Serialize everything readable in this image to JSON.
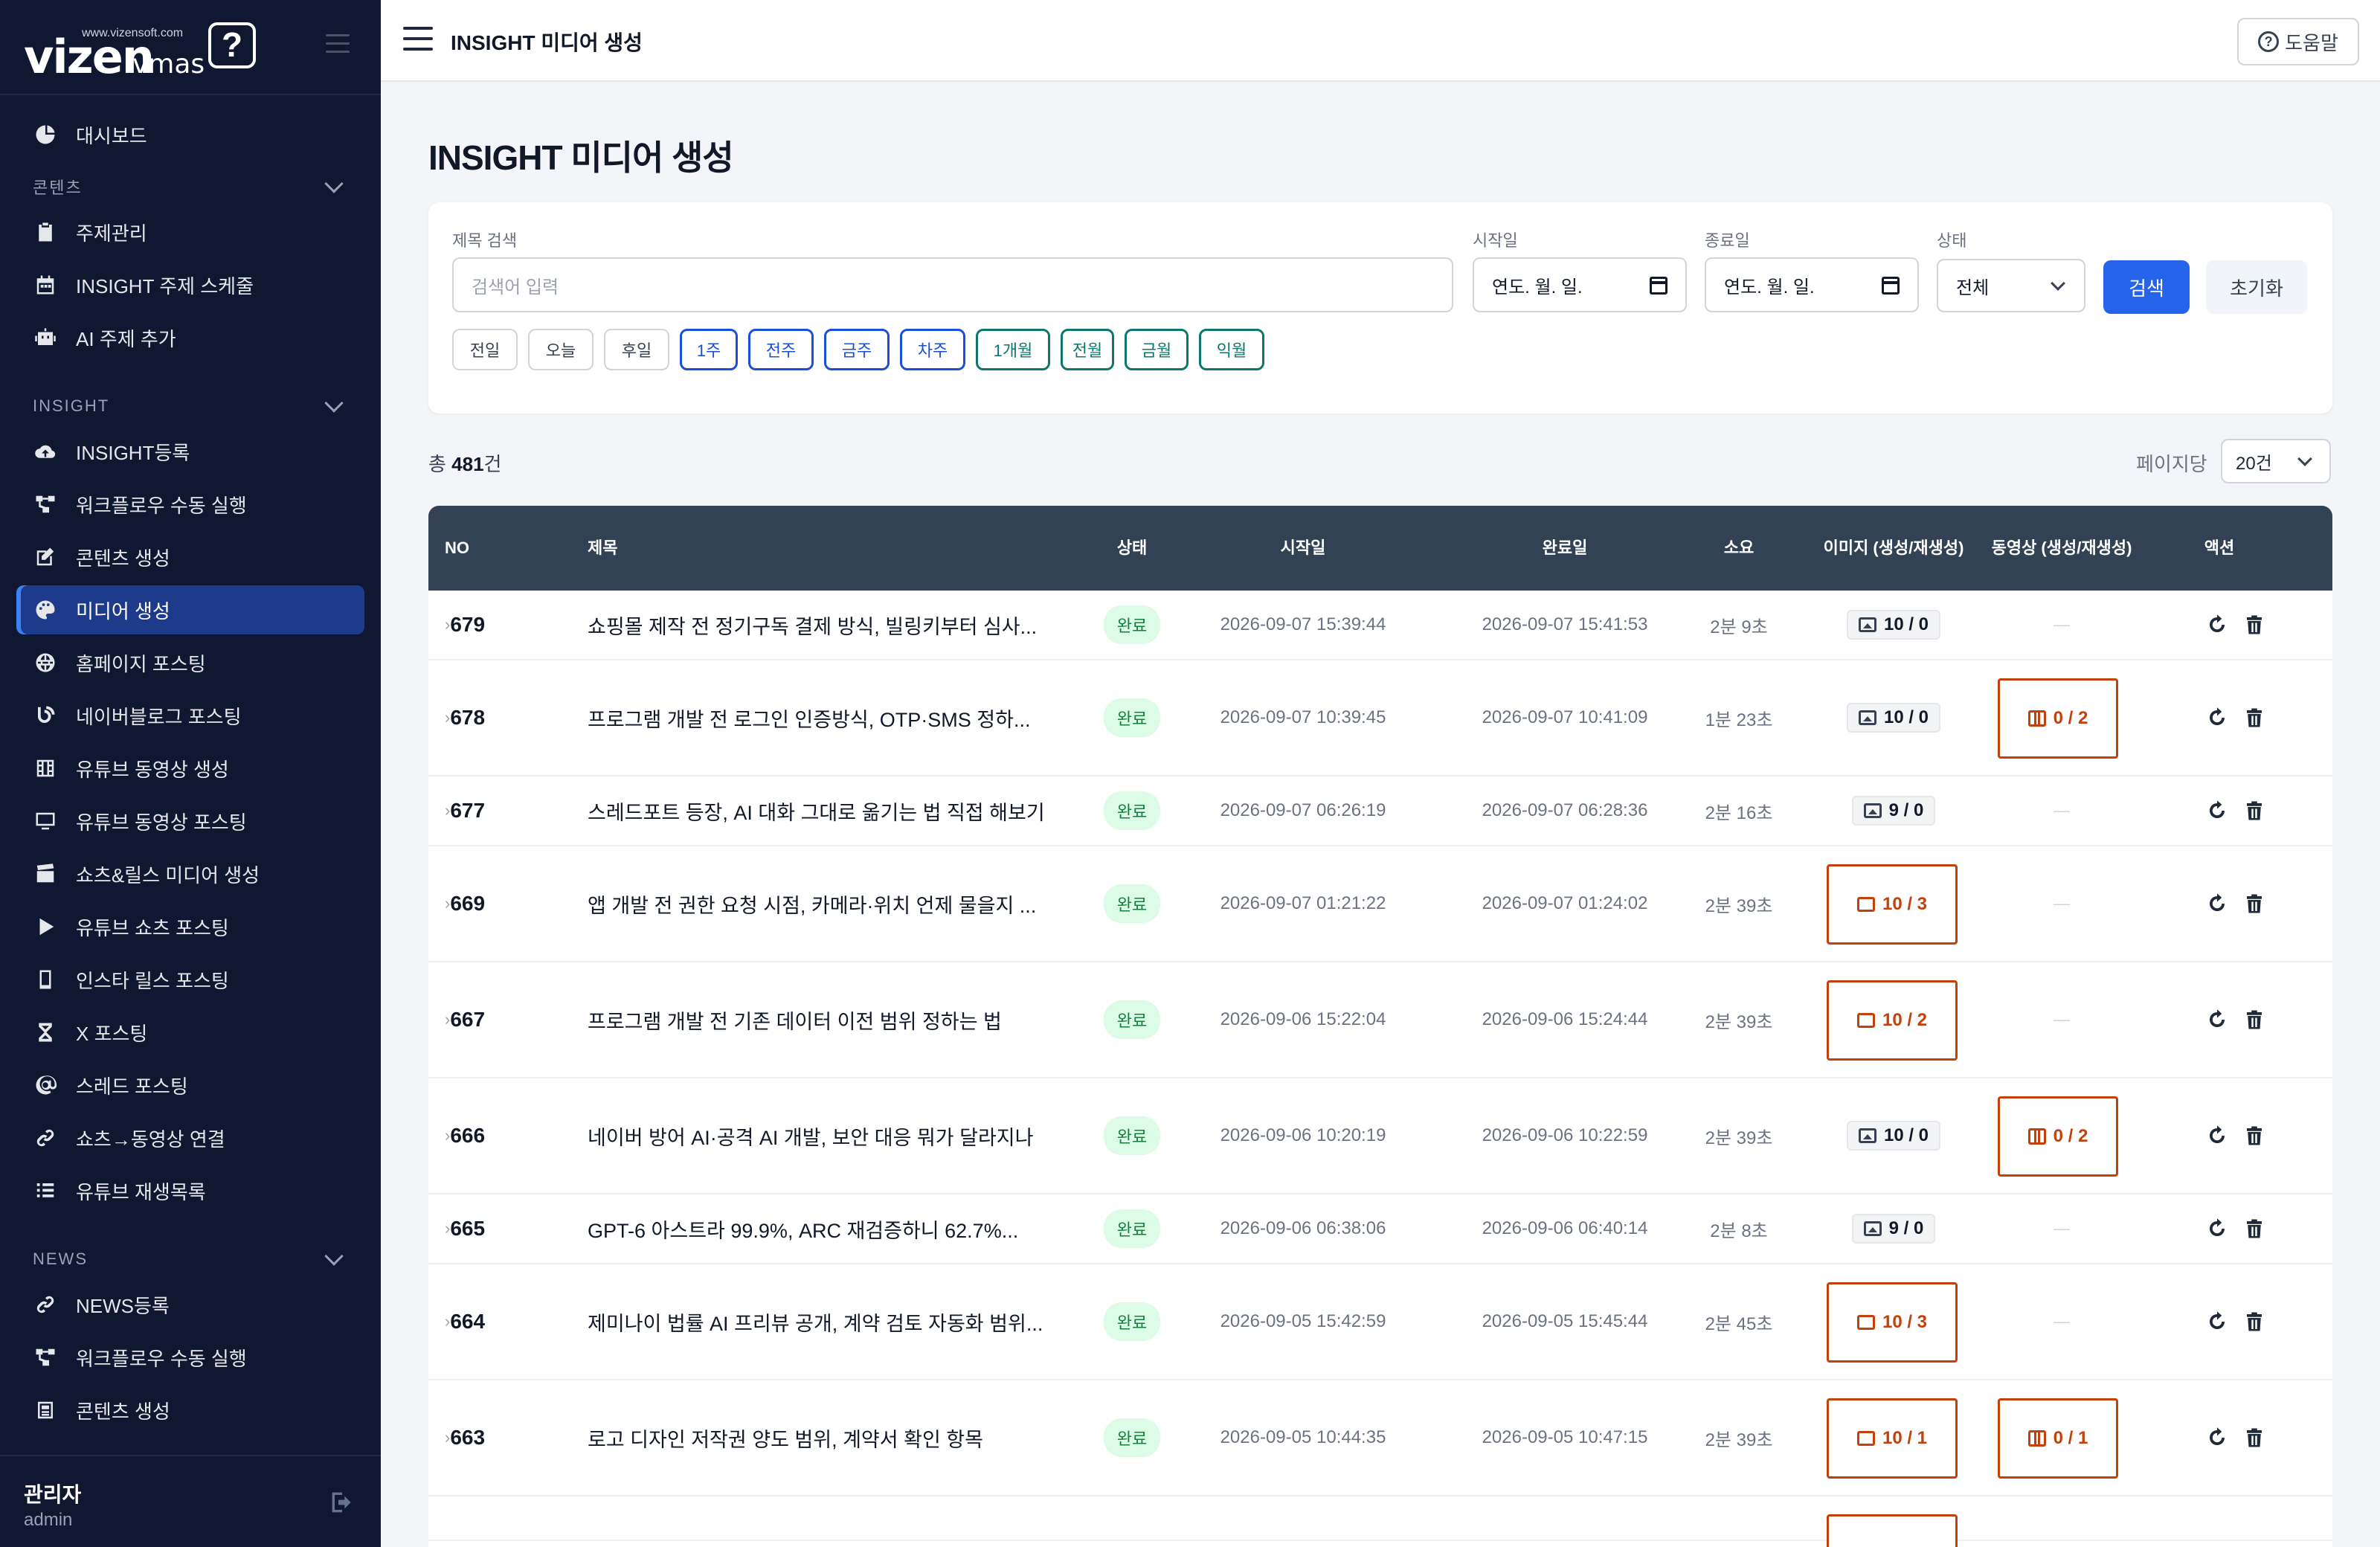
{
  "app": {
    "logo_brand": "vizen",
    "logo_product": "vmas",
    "logo_url": "www.vizensoft.com",
    "logo_bubble": "?"
  },
  "sidebar": {
    "top_item": {
      "label": "대시보드",
      "icon": "dashboard-icon"
    },
    "sections": [
      {
        "title": "콘텐츠",
        "items": [
          {
            "label": "주제관리",
            "icon": "clipboard-icon"
          },
          {
            "label": "INSIGHT 주제 스케줄",
            "icon": "calendar-icon"
          },
          {
            "label": "AI 주제 추가",
            "icon": "robot-icon"
          }
        ]
      },
      {
        "title": "INSIGHT",
        "items": [
          {
            "label": "INSIGHT등록",
            "icon": "cloud-upload-icon"
          },
          {
            "label": "워크플로우 수동 실행",
            "icon": "workflow-icon"
          },
          {
            "label": "콘텐츠 생성",
            "icon": "edit-icon"
          },
          {
            "label": "미디어 생성",
            "icon": "palette-icon",
            "active": true
          },
          {
            "label": "홈페이지 포스팅",
            "icon": "globe-icon"
          },
          {
            "label": "네이버블로그 포스팅",
            "icon": "blog-icon"
          },
          {
            "label": "유튜브 동영상 생성",
            "icon": "film-icon"
          },
          {
            "label": "유튜브 동영상 포스팅",
            "icon": "monitor-icon"
          },
          {
            "label": "쇼츠&릴스 미디어 생성",
            "icon": "clapper-icon"
          },
          {
            "label": "유튜브 쇼츠 포스팅",
            "icon": "play-icon"
          },
          {
            "label": "인스타 릴스 포스팅",
            "icon": "mobile-icon"
          },
          {
            "label": "X 포스팅",
            "icon": "x-icon"
          },
          {
            "label": "스레드 포스팅",
            "icon": "at-icon"
          },
          {
            "label": "쇼츠→동영상 연결",
            "icon": "link-icon"
          },
          {
            "label": "유튜브 재생목록",
            "icon": "list-icon"
          }
        ]
      },
      {
        "title": "NEWS",
        "items": [
          {
            "label": "NEWS등록",
            "icon": "link-icon"
          },
          {
            "label": "워크플로우 수동 실행",
            "icon": "workflow-icon"
          },
          {
            "label": "콘텐츠 생성",
            "icon": "newspaper-icon"
          }
        ]
      }
    ],
    "user": {
      "name": "관리자",
      "id": "admin"
    }
  },
  "header": {
    "crumb": "INSIGHT 미디어 생성",
    "help_label": "도움말"
  },
  "page": {
    "title": "INSIGHT 미디어 생성"
  },
  "filters": {
    "title_label": "제목 검색",
    "title_placeholder": "검색어 입력",
    "start_label": "시작일",
    "start_value": "연도. 월. 일.",
    "end_label": "종료일",
    "end_value": "연도. 월. 일.",
    "status_label": "상태",
    "status_value": "전체",
    "search_label": "검색",
    "reset_label": "초기화",
    "chips": [
      {
        "label": "전일",
        "style": "gray"
      },
      {
        "label": "오늘",
        "style": "gray"
      },
      {
        "label": "후일",
        "style": "gray"
      },
      {
        "label": "1주",
        "style": "blue"
      },
      {
        "label": "전주",
        "style": "blue"
      },
      {
        "label": "금주",
        "style": "blue"
      },
      {
        "label": "차주",
        "style": "blue"
      },
      {
        "label": "1개월",
        "style": "green"
      },
      {
        "label": "전월",
        "style": "green"
      },
      {
        "label": "금월",
        "style": "green"
      },
      {
        "label": "익월",
        "style": "green"
      }
    ]
  },
  "summary": {
    "total_prefix": "총 ",
    "total_count": "481",
    "total_suffix": "건",
    "per_page_label": "페이지당",
    "per_page_value": "20건"
  },
  "table": {
    "headers": {
      "no": "NO",
      "title": "제목",
      "status": "상태",
      "start": "시작일",
      "end": "완료일",
      "duration": "소요",
      "image": "이미지 (생성/재생성)",
      "video": "동영상 (생성/재생성)",
      "action": "액션"
    },
    "rows": [
      {
        "no": "679",
        "title": "쇼핑몰 제작 전 정기구독 결제 방식, 빌링키부터 심사...",
        "status": "완료",
        "start": "2026-09-07 15:39:44",
        "end": "2026-09-07 15:41:53",
        "duration": "2분 9초",
        "image": "10 / 0",
        "image_hl": false,
        "video": "—",
        "video_hl": false
      },
      {
        "no": "678",
        "title": "프로그램 개발 전 로그인 인증방식, OTP·SMS 정하...",
        "status": "완료",
        "start": "2026-09-07 10:39:45",
        "end": "2026-09-07 10:41:09",
        "duration": "1분 23초",
        "image": "10 / 0",
        "image_hl": false,
        "video": "0 / 2",
        "video_hl": true
      },
      {
        "no": "677",
        "title": "스레드포트 등장, AI 대화 그대로 옮기는 법 직접 해보기",
        "status": "완료",
        "start": "2026-09-07 06:26:19",
        "end": "2026-09-07 06:28:36",
        "duration": "2분 16초",
        "image": "9 / 0",
        "image_hl": false,
        "video": "—",
        "video_hl": false
      },
      {
        "no": "669",
        "title": "앱 개발 전 권한 요청 시점, 카메라·위치 언제 물을지 ...",
        "status": "완료",
        "start": "2026-09-07 01:21:22",
        "end": "2026-09-07 01:24:02",
        "duration": "2분 39초",
        "image": "10 / 3",
        "image_hl": true,
        "video": "—",
        "video_hl": false
      },
      {
        "no": "667",
        "title": "프로그램 개발 전 기존 데이터 이전 범위 정하는 법",
        "status": "완료",
        "start": "2026-09-06 15:22:04",
        "end": "2026-09-06 15:24:44",
        "duration": "2분 39초",
        "image": "10 / 2",
        "image_hl": true,
        "video": "—",
        "video_hl": false
      },
      {
        "no": "666",
        "title": "네이버 방어 AI·공격 AI 개발, 보안 대응 뭐가 달라지나",
        "status": "완료",
        "start": "2026-09-06 10:20:19",
        "end": "2026-09-06 10:22:59",
        "duration": "2분 39초",
        "image": "10 / 0",
        "image_hl": false,
        "video": "0 / 2",
        "video_hl": true
      },
      {
        "no": "665",
        "title": "GPT-6 아스트라 99.9%, ARC 재검증하니 62.7%...",
        "status": "완료",
        "start": "2026-09-06 06:38:06",
        "end": "2026-09-06 06:40:14",
        "duration": "2분 8초",
        "image": "9 / 0",
        "image_hl": false,
        "video": "—",
        "video_hl": false
      },
      {
        "no": "664",
        "title": "제미나이 법률 AI 프리뷰 공개, 계약 검토 자동화 범위...",
        "status": "완료",
        "start": "2026-09-05 15:42:59",
        "end": "2026-09-05 15:45:44",
        "duration": "2분 45초",
        "image": "10 / 3",
        "image_hl": true,
        "video": "—",
        "video_hl": false
      },
      {
        "no": "663",
        "title": "로고 디자인 저작권 양도 범위, 계약서 확인 항목",
        "status": "완료",
        "start": "2026-09-05 10:44:35",
        "end": "2026-09-05 10:47:15",
        "duration": "2분 39초",
        "image": "10 / 1",
        "image_hl": true,
        "video": "0 / 1",
        "video_hl": true
      }
    ]
  }
}
